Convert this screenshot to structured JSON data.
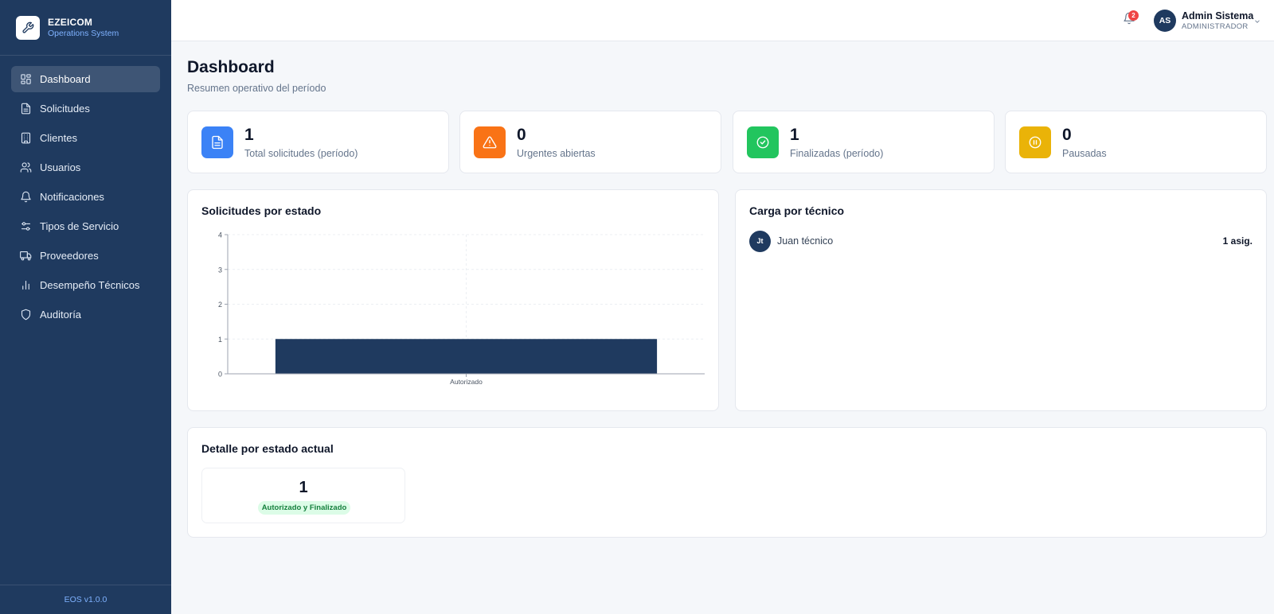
{
  "brand": {
    "name": "EZEICOM",
    "subtitle": "Operations System",
    "icon": "wrench-icon"
  },
  "sidebar": {
    "items": [
      {
        "label": "Dashboard",
        "icon": "grid-icon",
        "active": true
      },
      {
        "label": "Solicitudes",
        "icon": "document-icon"
      },
      {
        "label": "Clientes",
        "icon": "building-icon"
      },
      {
        "label": "Usuarios",
        "icon": "users-icon"
      },
      {
        "label": "Notificaciones",
        "icon": "bell-icon"
      },
      {
        "label": "Tipos de Servicio",
        "icon": "sliders-icon"
      },
      {
        "label": "Proveedores",
        "icon": "truck-icon"
      },
      {
        "label": "Desempeño Técnicos",
        "icon": "bar-chart-icon"
      },
      {
        "label": "Auditoría",
        "icon": "shield-icon"
      }
    ],
    "version": "EOS v1.0.0"
  },
  "topbar": {
    "notification_count": "2",
    "user": {
      "initials": "AS",
      "name": "Admin Sistema",
      "role": "ADMINISTRADOR"
    }
  },
  "page": {
    "title": "Dashboard",
    "subtitle": "Resumen operativo del período"
  },
  "stats": [
    {
      "value": "1",
      "label": "Total solicitudes (período)",
      "icon": "document-icon",
      "color": "#3b82f6"
    },
    {
      "value": "0",
      "label": "Urgentes abiertas",
      "icon": "warning-icon",
      "color": "#f97316"
    },
    {
      "value": "1",
      "label": "Finalizadas (período)",
      "icon": "check-circle-icon",
      "color": "#22c55e"
    },
    {
      "value": "0",
      "label": "Pausadas",
      "icon": "pause-circle-icon",
      "color": "#eab308"
    }
  ],
  "status_chart": {
    "title": "Solicitudes por estado",
    "chart_data": {
      "type": "bar",
      "categories": [
        "Autorizado"
      ],
      "values": [
        1
      ],
      "ylim": [
        0,
        4
      ],
      "yticks": [
        0,
        1,
        2,
        3,
        4
      ],
      "grid": true,
      "color": "#1f3a5f"
    }
  },
  "tech_load": {
    "title": "Carga por técnico",
    "items": [
      {
        "initials": "Jt",
        "name": "Juan técnico",
        "count": "1 asig."
      }
    ]
  },
  "detail": {
    "title": "Detalle por estado actual",
    "items": [
      {
        "value": "1",
        "badge": "Autorizado y Finalizado"
      }
    ]
  }
}
